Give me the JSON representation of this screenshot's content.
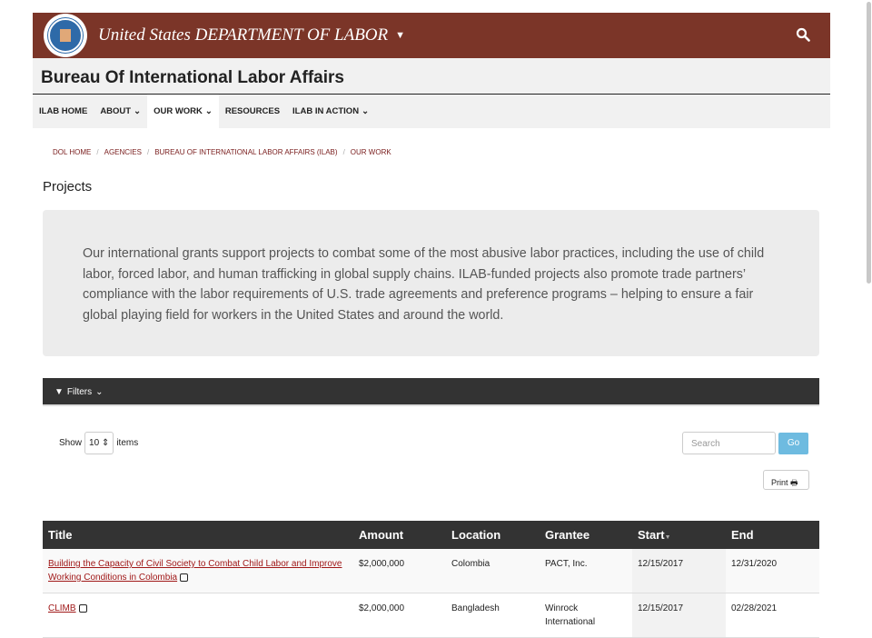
{
  "header": {
    "agency": "United States DEPARTMENT OF LABOR",
    "bureau": "Bureau Of International Labor Affairs"
  },
  "nav": [
    {
      "label": "ILAB HOME",
      "dropdown": false
    },
    {
      "label": "ABOUT",
      "dropdown": true
    },
    {
      "label": "OUR WORK",
      "dropdown": true,
      "active": true
    },
    {
      "label": "RESOURCES",
      "dropdown": false
    },
    {
      "label": "ILAB IN ACTION",
      "dropdown": true
    }
  ],
  "breadcrumb": [
    "DOL HOME",
    "AGENCIES",
    "BUREAU OF INTERNATIONAL LABOR AFFAIRS (ILAB)",
    "OUR WORK"
  ],
  "page_title": "Projects",
  "intro": "Our international grants support projects to combat some of the most abusive labor practices, including the use of child labor, forced labor, and human trafficking in global supply chains. ILAB-funded projects also promote trade partners’ compliance with the labor requirements of U.S. trade agreements and preference programs – helping to ensure a fair global playing field for workers in the United States and around the world.",
  "filters_label": "Filters",
  "controls": {
    "show": "Show",
    "page_size": "10",
    "items": "items",
    "search_placeholder": "Search",
    "go": "Go",
    "print": "Print"
  },
  "table": {
    "columns": [
      "Title",
      "Amount",
      "Location",
      "Grantee",
      "Start",
      "End"
    ],
    "sorted_column": "Start",
    "rows": [
      {
        "title": "Building the Capacity of Civil Society to Combat Child Labor and Improve Working Conditions in Colombia",
        "amount": "$2,000,000",
        "location": "Colombia",
        "grantee": "PACT, Inc.",
        "start": "12/15/2017",
        "end": "12/31/2020"
      },
      {
        "title": "CLIMB",
        "amount": "$2,000,000",
        "location": "Bangladesh",
        "grantee": "Winrock International",
        "start": "12/15/2017",
        "end": "02/28/2021"
      }
    ]
  },
  "colors": {
    "brand": "#7b3528",
    "link": "#a01818",
    "go_button": "#6ebbe0",
    "dark_bar": "#333333"
  }
}
